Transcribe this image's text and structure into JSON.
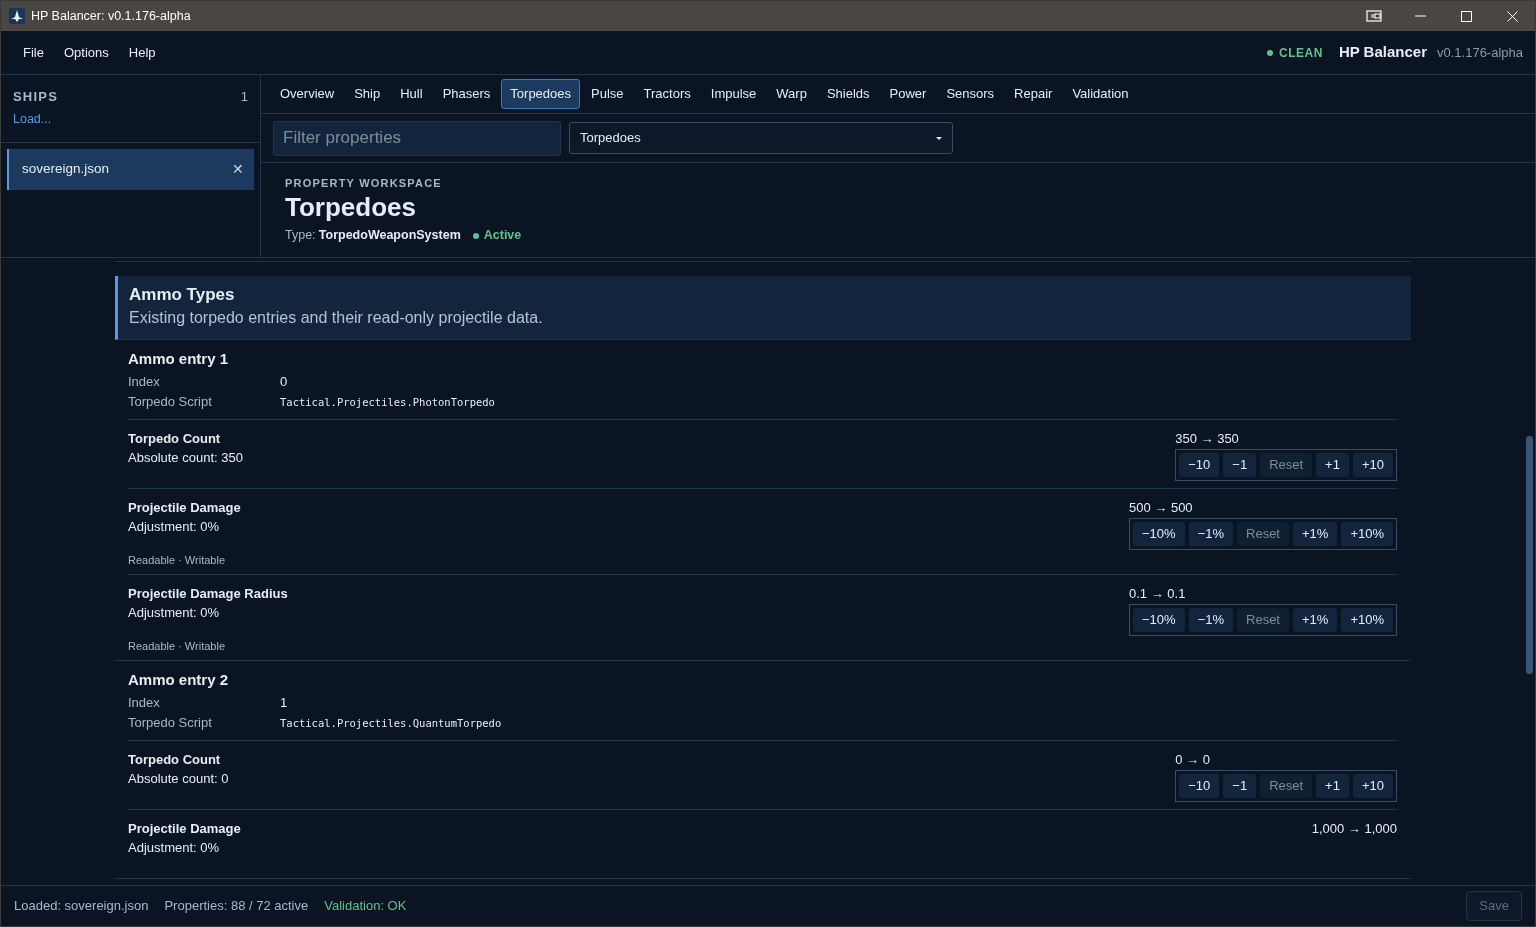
{
  "window": {
    "title": "HP Balancer: v0.1.176-alpha"
  },
  "menu": [
    "File",
    "Options",
    "Help"
  ],
  "header_status": {
    "label": "CLEAN"
  },
  "app": {
    "name": "HP Balancer",
    "version": "v0.1.176-alpha"
  },
  "sidebar": {
    "title": "SHIPS",
    "count": "1",
    "load_link": "Load...",
    "files": [
      {
        "name": "sovereign.json",
        "selected": true,
        "close": "✕"
      }
    ]
  },
  "tabs": [
    {
      "label": "Overview",
      "selected": false
    },
    {
      "label": "Ship",
      "selected": false
    },
    {
      "label": "Hull",
      "selected": false
    },
    {
      "label": "Phasers",
      "selected": false
    },
    {
      "label": "Torpedoes",
      "selected": true
    },
    {
      "label": "Pulse",
      "selected": false
    },
    {
      "label": "Tractors",
      "selected": false
    },
    {
      "label": "Impulse",
      "selected": false
    },
    {
      "label": "Warp",
      "selected": false
    },
    {
      "label": "Shields",
      "selected": false
    },
    {
      "label": "Power",
      "selected": false
    },
    {
      "label": "Sensors",
      "selected": false
    },
    {
      "label": "Repair",
      "selected": false
    },
    {
      "label": "Validation",
      "selected": false
    }
  ],
  "filter": {
    "placeholder": "Filter properties"
  },
  "category_select": {
    "value": "Torpedoes"
  },
  "workspace": {
    "eyebrow": "PROPERTY WORKSPACE",
    "title": "Torpedoes",
    "type_label": "Type:",
    "type_value": "TorpedoWeaponSystem",
    "state": "Active"
  },
  "section": {
    "title": "Ammo Types",
    "description": "Existing torpedo entries and their read-only projectile data."
  },
  "entries": [
    {
      "title": "Ammo entry 1",
      "fields": [
        {
          "label": "Index",
          "value": "0",
          "kind": "text"
        },
        {
          "label": "Torpedo Script",
          "value": "Tactical.Projectiles.PhotonTorpedo",
          "kind": "code"
        }
      ],
      "properties": [
        {
          "name": "Torpedo Count",
          "detail": "Absolute count: 350",
          "reading": "350 → 350",
          "buttons": [
            {
              "label": "−10",
              "disabled": false
            },
            {
              "label": "−1",
              "disabled": false
            },
            {
              "label": "Reset",
              "disabled": true
            },
            {
              "label": "+1",
              "disabled": false
            },
            {
              "label": "+10",
              "disabled": false
            }
          ]
        },
        {
          "name": "Projectile Damage",
          "detail": "Adjustment: 0%",
          "flags": "Readable · Writable",
          "reading": "500 → 500",
          "buttons": [
            {
              "label": "−10%",
              "disabled": false
            },
            {
              "label": "−1%",
              "disabled": false
            },
            {
              "label": "Reset",
              "disabled": true
            },
            {
              "label": "+1%",
              "disabled": false
            },
            {
              "label": "+10%",
              "disabled": false
            }
          ]
        },
        {
          "name": "Projectile Damage Radius",
          "detail": "Adjustment: 0%",
          "flags": "Readable · Writable",
          "reading": "0.1 → 0.1",
          "buttons": [
            {
              "label": "−10%",
              "disabled": false
            },
            {
              "label": "−1%",
              "disabled": false
            },
            {
              "label": "Reset",
              "disabled": true
            },
            {
              "label": "+1%",
              "disabled": false
            },
            {
              "label": "+10%",
              "disabled": false
            }
          ]
        }
      ]
    },
    {
      "title": "Ammo entry 2",
      "fields": [
        {
          "label": "Index",
          "value": "1",
          "kind": "text"
        },
        {
          "label": "Torpedo Script",
          "value": "Tactical.Projectiles.QuantumTorpedo",
          "kind": "code"
        }
      ],
      "properties": [
        {
          "name": "Torpedo Count",
          "detail": "Absolute count: 0",
          "reading": "0 → 0",
          "buttons": [
            {
              "label": "−10",
              "disabled": false
            },
            {
              "label": "−1",
              "disabled": false
            },
            {
              "label": "Reset",
              "disabled": true
            },
            {
              "label": "+1",
              "disabled": false
            },
            {
              "label": "+10",
              "disabled": false
            }
          ]
        },
        {
          "name": "Projectile Damage",
          "detail": "Adjustment: 0%",
          "reading": "1,000 → 1,000"
        }
      ]
    }
  ],
  "status_bar": {
    "loaded": "Loaded: sovereign.json",
    "properties": "Properties: 88 / 72 active",
    "validation": "Validation: OK"
  },
  "save": {
    "label": "Save",
    "disabled": true
  }
}
